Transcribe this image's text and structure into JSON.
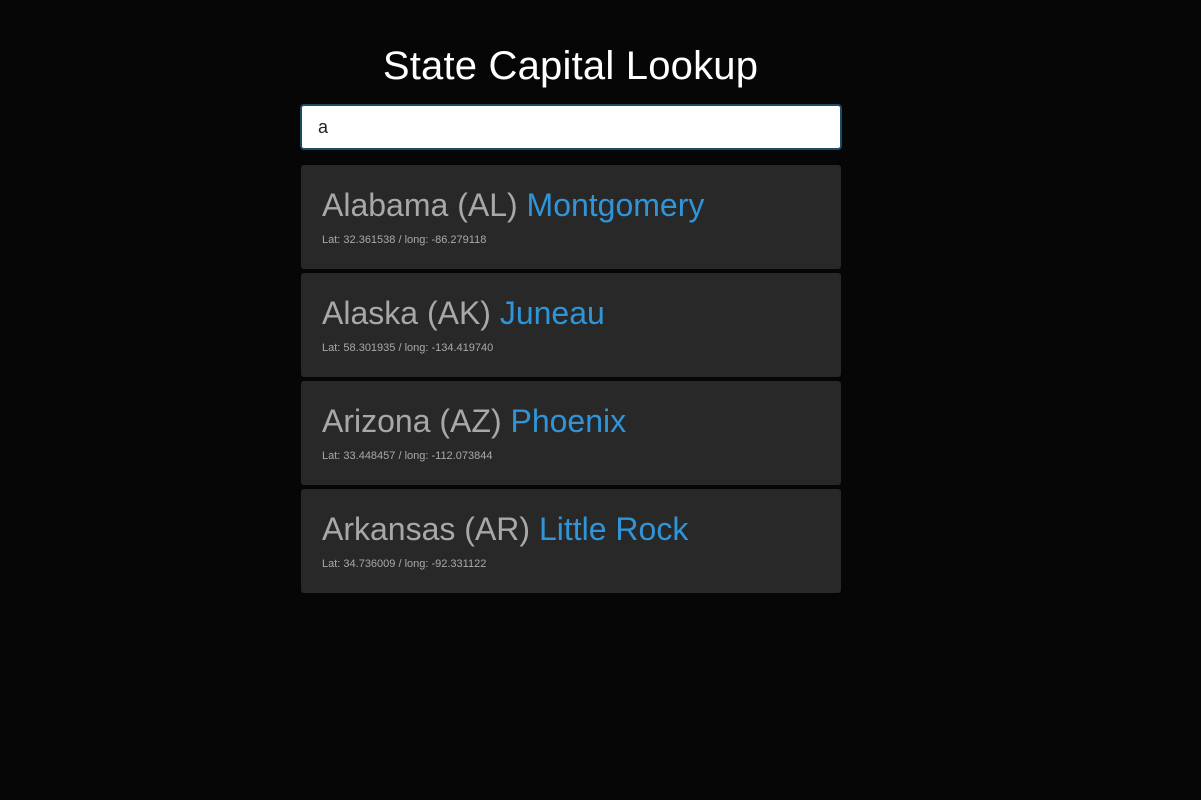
{
  "header": {
    "title": "State Capital Lookup"
  },
  "search": {
    "value": "a",
    "placeholder": ""
  },
  "results": [
    {
      "state": "Alabama (AL)",
      "capital": "Montgomery",
      "coords": "Lat: 32.361538 / long: -86.279118"
    },
    {
      "state": "Alaska (AK)",
      "capital": "Juneau",
      "coords": "Lat: 58.301935 / long: -134.419740"
    },
    {
      "state": "Arizona (AZ)",
      "capital": "Phoenix",
      "coords": "Lat: 33.448457 / long: -112.073844"
    },
    {
      "state": "Arkansas (AR)",
      "capital": "Little Rock",
      "coords": "Lat: 34.736009 / long: -92.331122"
    }
  ],
  "colors": {
    "background": "#060606",
    "card": "#282828",
    "capital_accent": "#2f95d8",
    "state_text": "#a8a8a8"
  }
}
